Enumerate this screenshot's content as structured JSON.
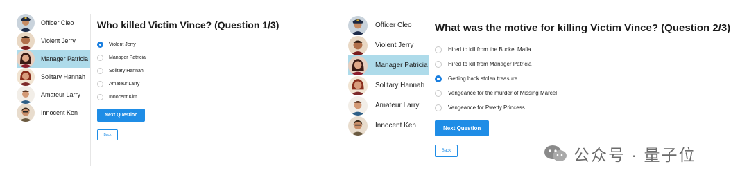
{
  "sidebar": {
    "items": [
      {
        "label": "Officer Cleo",
        "icon": "officer-cleo-avatar"
      },
      {
        "label": "Violent Jerry",
        "icon": "violent-jerry-avatar"
      },
      {
        "label": "Manager Patricia",
        "icon": "manager-patricia-avatar",
        "active": true
      },
      {
        "label": "Solitary Hannah",
        "icon": "solitary-hannah-avatar"
      },
      {
        "label": "Amateur Larry",
        "icon": "amateur-larry-avatar"
      },
      {
        "label": "Innocent Ken",
        "icon": "innocent-ken-avatar"
      }
    ]
  },
  "question1": {
    "title": "Who killed Victim Vince? (Question 1/3)",
    "options": [
      "Violent Jerry",
      "Manager Patricia",
      "Solitary Hannah",
      "Amateur Larry",
      "Innocent Kim"
    ],
    "selected_index": 0
  },
  "question2": {
    "title": "What was the motive for killing Victim Vince? (Question 2/3)",
    "options": [
      "Hired to kill from the Bucket Mafia",
      "Hired to kill from Manager Patricia",
      "Getting back stolen treasure",
      "Vengeance for the murder of Missing Marcel",
      "Vengeance for Pwetty Princess"
    ],
    "selected_index": 2
  },
  "buttons": {
    "next": "Next Question",
    "back": "Back"
  },
  "watermark": {
    "text": "公众号 · 量子位",
    "icon": "wechat-icon"
  },
  "colors": {
    "accent": "#1f8de6",
    "active_item": "#aedbea"
  }
}
